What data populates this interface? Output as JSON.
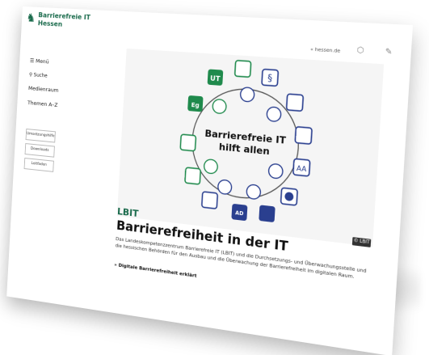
{
  "brand": {
    "line1": "Barrierefreie IT",
    "line2": "Hessen"
  },
  "topbar": {
    "link": "« hessen.de"
  },
  "nav": {
    "menu": "☰ Menü",
    "search": "⚲ Suche",
    "media": "Medienraum",
    "topics": "Themen A–Z"
  },
  "side_buttons": [
    "Umsetzungshilfe",
    "Downloads",
    "Leitfaden"
  ],
  "hero": {
    "center_line1": "Barrierefreie IT",
    "center_line2": "hilft allen"
  },
  "hero_icons": {
    "ut": "UT",
    "paragraph": "§",
    "eg": "Eg",
    "aa": "AA",
    "ad": "AD"
  },
  "tag": "LBIT",
  "heading": "Barrierefreiheit in der IT",
  "badge": "© LBIT",
  "body": "Das Landeskompetenzzentrum Barrierefreie IT (LBIT) und die Durchsetzungs- und Überwachungsstelle und die hessischen Behörden für den Ausbau und die Überwachung der Barrierefreiheit im digitalen Raum.",
  "link": "» Digitale Barrierefreiheit erklärt",
  "colors": {
    "brand": "#1a6b4c",
    "icon_blue": "#2a3f8f",
    "icon_green": "#1f8a4c"
  }
}
